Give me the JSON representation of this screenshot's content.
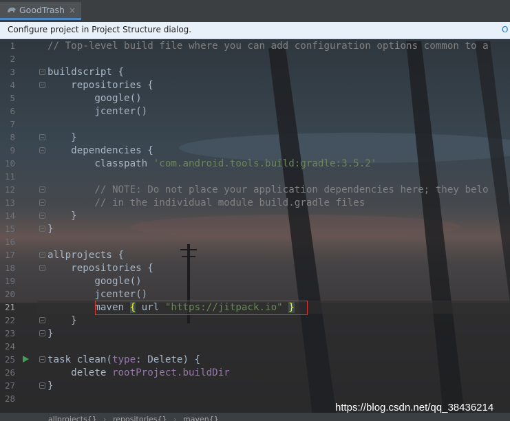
{
  "tab": {
    "title": "GoodTrash",
    "close": "×"
  },
  "notice": {
    "message": "Configure project in Project Structure dialog.",
    "action": "O"
  },
  "line_numbers": [
    "1",
    "2",
    "3",
    "4",
    "5",
    "6",
    "7",
    "8",
    "9",
    "10",
    "11",
    "12",
    "13",
    "14",
    "15",
    "16",
    "17",
    "18",
    "19",
    "20",
    "21",
    "22",
    "23",
    "24",
    "25",
    "26",
    "27",
    "28"
  ],
  "current_line": "21",
  "code": {
    "l1": "// Top-level build file where you can add configuration options common to a",
    "l3": "buildscript {",
    "l4": "    repositories {",
    "l5": "        google()",
    "l6": "        jcenter()",
    "l8": "    }",
    "l9": "    dependencies {",
    "l10_a": "        classpath ",
    "l10_b": "'com.android.tools.build:gradle:3.5.2'",
    "l12": "        // NOTE: Do not place your application dependencies here; they belo",
    "l13": "        // in the individual module build.gradle files",
    "l14": "    }",
    "l15": "}",
    "l17": "allprojects {",
    "l18": "    repositories {",
    "l19": "        google()",
    "l20": "        jcenter()",
    "l21_a": "        maven ",
    "l21_b": "{",
    "l21_c": " url ",
    "l21_d": "\"https://jitpack.io\"",
    "l21_e": " ",
    "l21_f": "}",
    "l22": "    }",
    "l23": "}",
    "l25_a": "task clean(",
    "l25_b": "type",
    "l25_c": ": Delete) {",
    "l26_a": "    delete ",
    "l26_b": "rootProject.buildDir",
    "l27": "}"
  },
  "breadcrumb": [
    "allprojects{}",
    "repositories{}",
    "maven{}"
  ],
  "watermark": "https://blog.csdn.net/qq_38436214",
  "colors": {
    "comment": "#808080",
    "string": "#6a8759",
    "property": "#9876aa",
    "text": "#a9b7c6",
    "highlight_border": "#e03434",
    "brace_match": "#ffef28"
  }
}
